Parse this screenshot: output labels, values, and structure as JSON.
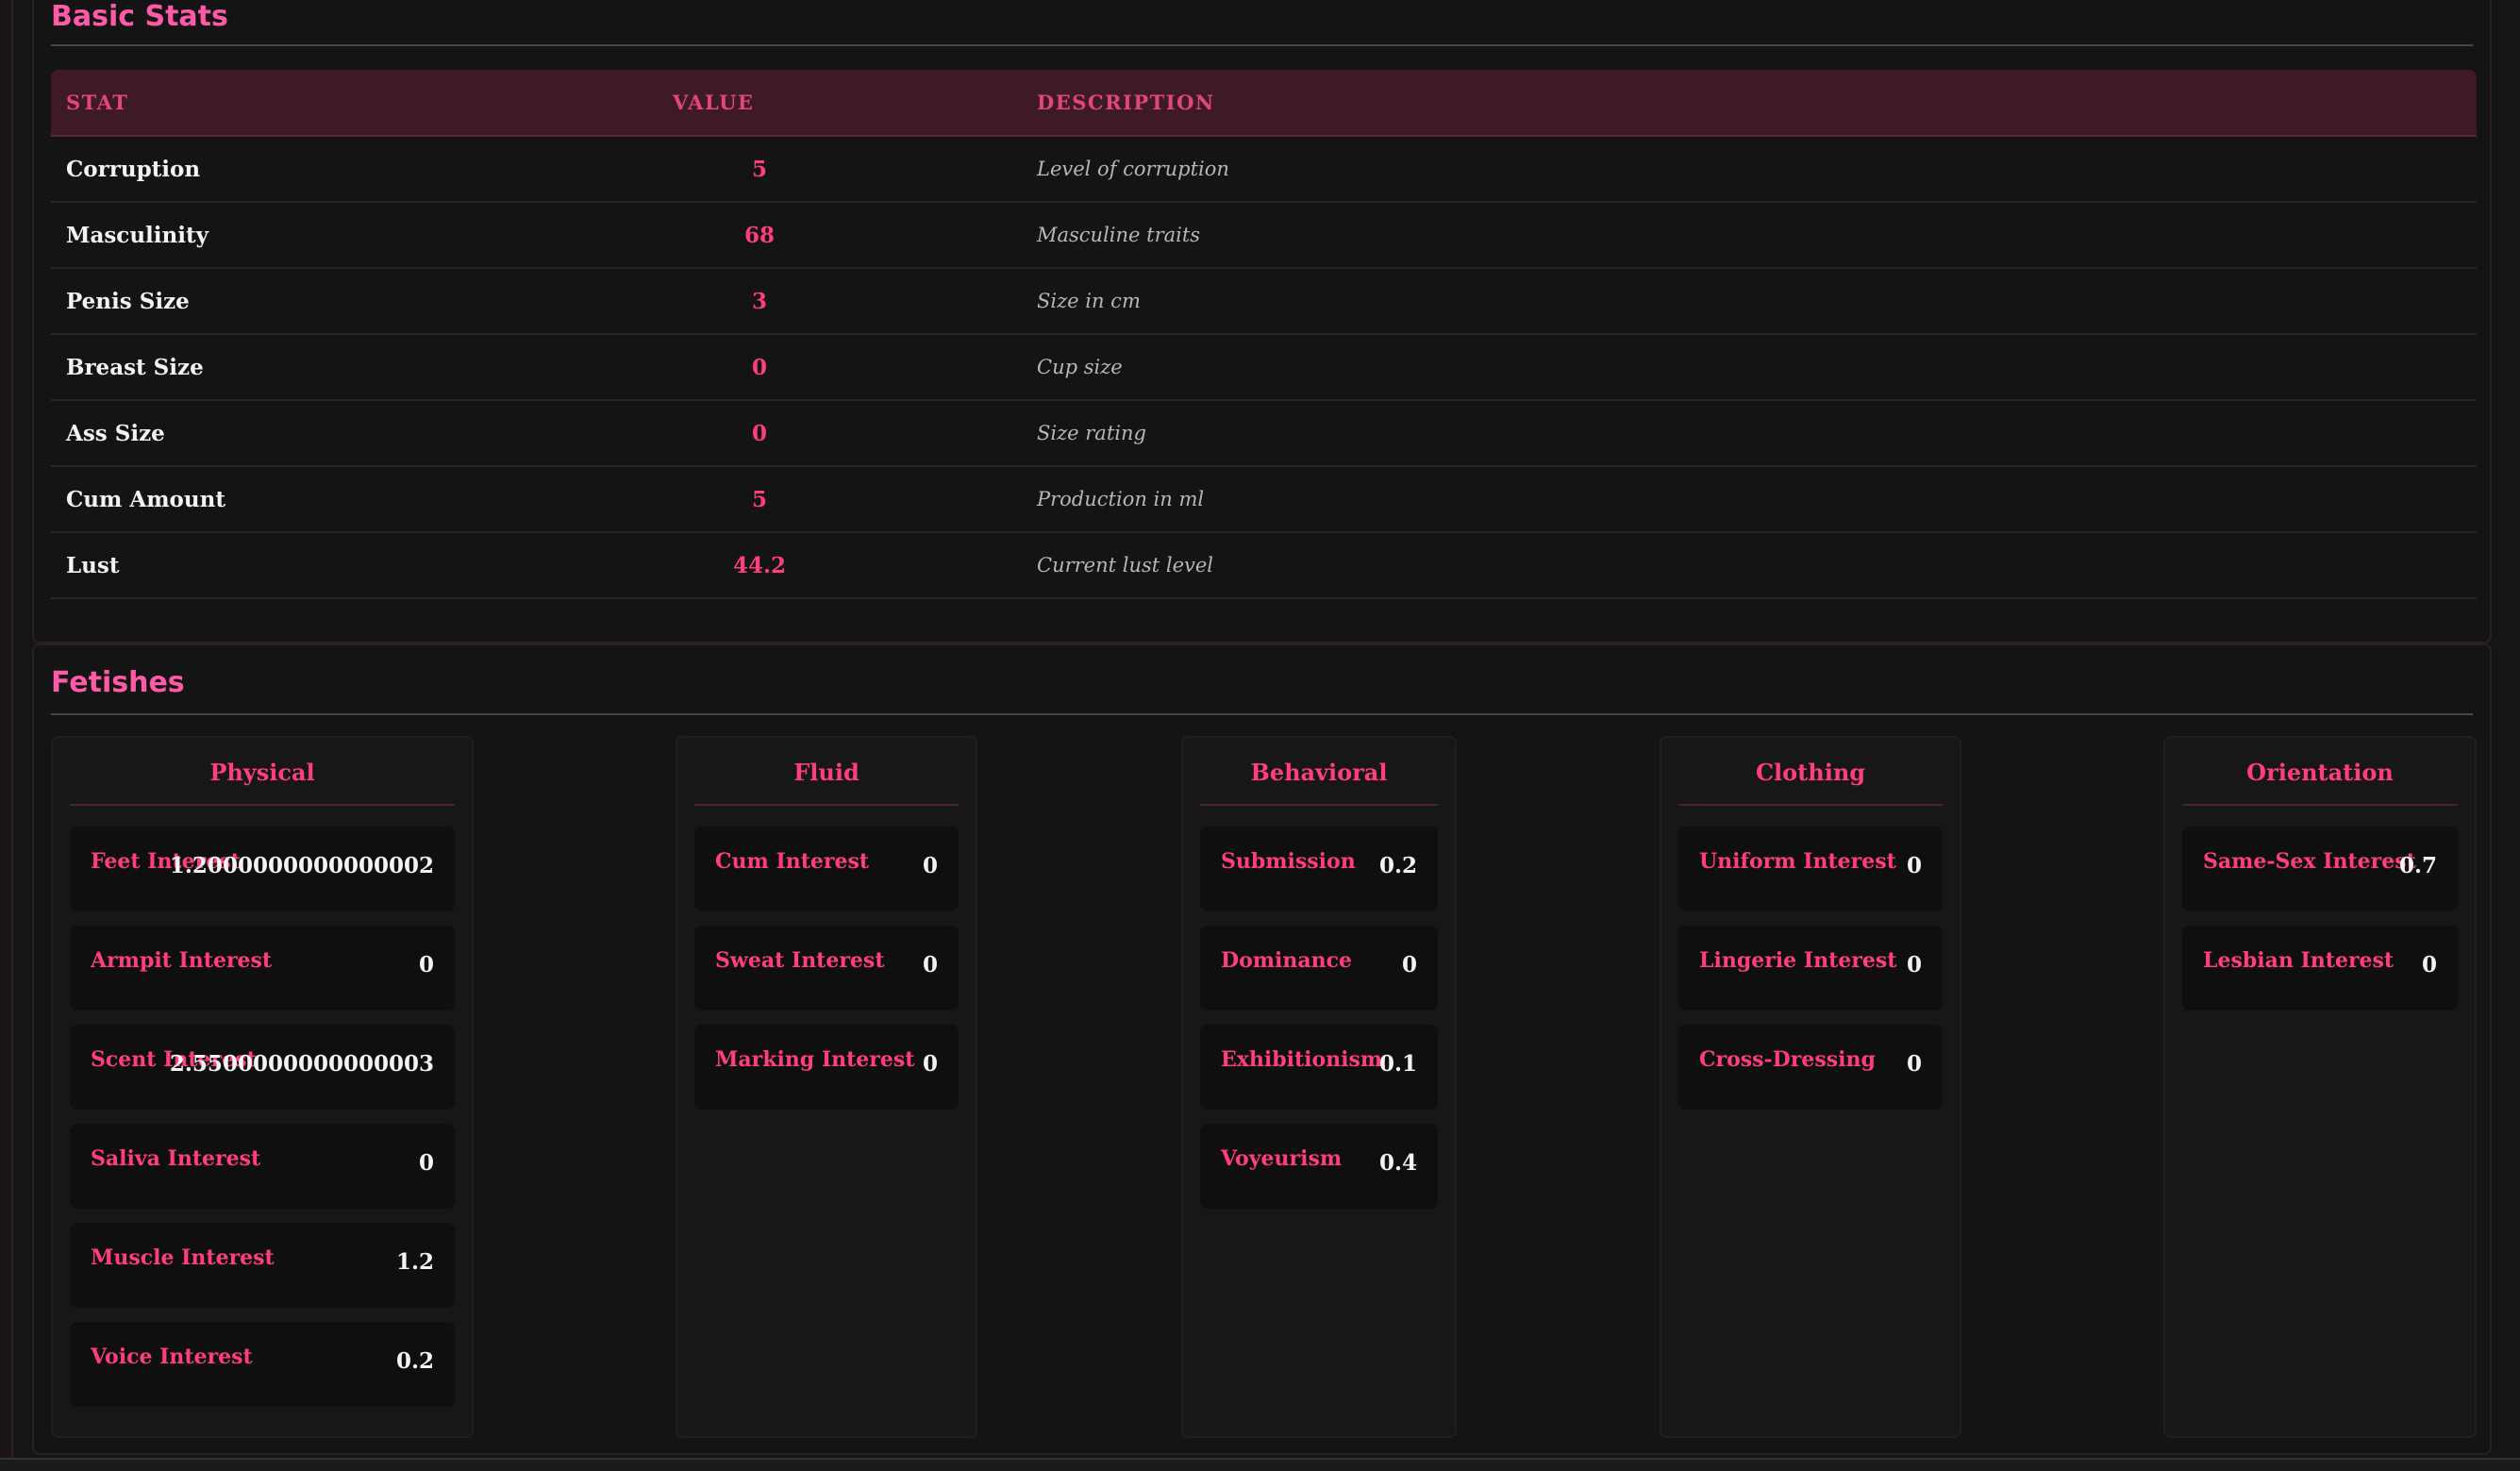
{
  "basic_stats": {
    "title": "Basic Stats",
    "headers": [
      "STAT",
      "VALUE",
      "DESCRIPTION"
    ],
    "rows": [
      {
        "stat": "Corruption",
        "value": "5",
        "description": "Level of corruption"
      },
      {
        "stat": "Masculinity",
        "value": "68",
        "description": "Masculine traits"
      },
      {
        "stat": "Penis Size",
        "value": "3",
        "description": "Size in cm"
      },
      {
        "stat": "Breast Size",
        "value": "0",
        "description": "Cup size"
      },
      {
        "stat": "Ass Size",
        "value": "0",
        "description": "Size rating"
      },
      {
        "stat": "Cum Amount",
        "value": "5",
        "description": "Production in ml"
      },
      {
        "stat": "Lust",
        "value": "44.2",
        "description": "Current lust level"
      }
    ]
  },
  "fetishes": {
    "title": "Fetishes",
    "categories": [
      {
        "name": "Physical",
        "items": [
          {
            "label": "Feet Interest",
            "value": "1.2000000000000002"
          },
          {
            "label": "Armpit Interest",
            "value": "0"
          },
          {
            "label": "Scent Interest",
            "value": "2.5500000000000003"
          },
          {
            "label": "Saliva Interest",
            "value": "0"
          },
          {
            "label": "Muscle Interest",
            "value": "1.2"
          },
          {
            "label": "Voice Interest",
            "value": "0.2"
          }
        ]
      },
      {
        "name": "Fluid",
        "items": [
          {
            "label": "Cum Interest",
            "value": "0"
          },
          {
            "label": "Sweat Interest",
            "value": "0"
          },
          {
            "label": "Marking Interest",
            "value": "0"
          }
        ]
      },
      {
        "name": "Behavioral",
        "items": [
          {
            "label": "Submission",
            "value": "0.2"
          },
          {
            "label": "Dominance",
            "value": "0"
          },
          {
            "label": "Exhibitionism",
            "value": "0.1"
          },
          {
            "label": "Voyeurism",
            "value": "0.4"
          }
        ]
      },
      {
        "name": "Clothing",
        "items": [
          {
            "label": "Uniform Interest",
            "value": "0"
          },
          {
            "label": "Lingerie Interest",
            "value": "0"
          },
          {
            "label": "Cross-Dressing",
            "value": "0"
          }
        ]
      },
      {
        "name": "Orientation",
        "items": [
          {
            "label": "Same-Sex Interest",
            "value": "0.7"
          },
          {
            "label": "Lesbian Interest",
            "value": "0"
          }
        ]
      }
    ]
  },
  "colors": {
    "accent": "#ff3d7f",
    "title_pink": "#ff5aa8",
    "header_bg": "#3e1a26",
    "background": "#141414"
  }
}
